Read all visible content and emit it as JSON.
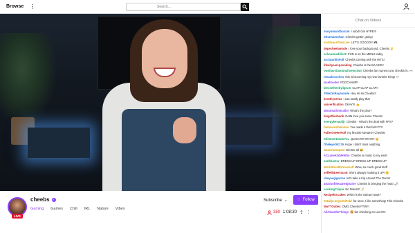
{
  "topbar": {
    "browse_label": "Browse",
    "more_label": "⋮",
    "search_placeholder": "Search..."
  },
  "stream": {
    "channel_name": "cheebs",
    "live_label": "LIVE",
    "tags": [
      "Gaming",
      "Games",
      "Chill",
      "IRL",
      "Nature",
      "Vibes"
    ],
    "subscribe_label": "Subscribe",
    "follow_label": "Follow",
    "viewer_count": "350",
    "uptime": "1:08:30"
  },
  "chat": {
    "title": "Chat on Videos",
    "messages": [
      {
        "user": "maryamandburcim",
        "text": "I subd! Get HYPE!!!",
        "color": "#1e6fd9"
      },
      {
        "user": "ShunnamChan",
        "text": "Cheebs gettin' going!",
        "color": "#1e6fd9"
      },
      {
        "user": "IceGlanceThruLive",
        "text": "LET'S GOOOO!!! 🎮",
        "color": "#d6a000"
      },
      {
        "user": "depecheelamode",
        "text": "I love your background, Cheebs 💡",
        "color": "#c01818"
      },
      {
        "user": "echoarmadillo22",
        "text": "FUN is on the MENU today",
        "color": "#1aa36b"
      },
      {
        "user": "arcSpardinFull",
        "text": "Cheebs coming with the HITS!",
        "color": "#1e6fd9"
      },
      {
        "user": "lifeeityearcpcooking",
        "text": "Cheebs is the BAAEE!!!",
        "color": "#c01818"
      },
      {
        "user": "ownhavsitantunahoetsxtwo",
        "text": "Cheebs fan numero uno checkin in. 👀",
        "color": "#1aa36b"
      },
      {
        "user": "ninaalecochoo",
        "text": "this is becoming my new favorite thing! 👀",
        "color": "#1e6fd9"
      },
      {
        "user": "lacellouder",
        "text": "POGCHAMP!",
        "color": "#8a3ffc"
      },
      {
        "user": "blessetheebyligrum",
        "text": "CLAP CLAP CLAP!!",
        "color": "#1aa36b"
      },
      {
        "user": "TrBeZinRaymonde",
        "text": "Hey Hi! Hi Cheebs!!",
        "color": "#1e6fd9"
      },
      {
        "user": "bestthyseeas",
        "text": "I can totally play that",
        "color": "#c01818"
      },
      {
        "user": "univerification",
        "text": "OKAY!!! 👍",
        "color": "#c01818"
      },
      {
        "user": "aboutsuthmicallor",
        "text": "What's the plan?",
        "color": "#8a3ffc"
      },
      {
        "user": "kingofburbank",
        "text": "Gotta love you some Cheebs",
        "color": "#c01818"
      },
      {
        "user": "energykevaultjr",
        "text": "Cheebs - What's the deal with FPS?",
        "color": "#1aa36b"
      },
      {
        "user": "fantuarsinhkinone",
        "text": "You made it this far!!!!?!?!",
        "color": "#d6a000"
      },
      {
        "user": "FullerOnHerRoll",
        "text": "my favorite streamer Cheebs!",
        "color": "#c01818"
      },
      {
        "user": "ShimmerDownYou",
        "text": "Queen!!!!!!!!!!!!!!!!!!! 👑",
        "color": "#1aa36b"
      },
      {
        "user": "OhHeyeOK176",
        "text": "Hope I didn't miss anything",
        "color": "#1e6fd9"
      },
      {
        "user": "wavestunnpwd",
        "text": "Gimme all 😆",
        "color": "#d6a000"
      },
      {
        "user": "ACLaneKlableWho",
        "text": "Cheebs is music to my ears!",
        "color": "#8a3ffc"
      },
      {
        "user": "sunkhamor",
        "text": "DRESS UP DRESS UP DRESS UP",
        "color": "#1aa36b"
      },
      {
        "user": "WorldGiveltlaYourself",
        "text": "Wow, so much good stuff",
        "color": "#d6a000"
      },
      {
        "user": "seffHill4reerScott",
        "text": "She's always hooking it UP! 🙂",
        "color": "#c01818"
      },
      {
        "user": "cheyesgigarroo",
        "text": "let's take a trip Around The Room!",
        "color": "#1e6fd9"
      },
      {
        "user": "attackoftheaaneighaine",
        "text": "Cheebs is bringing the heat! 🌶",
        "color": "#8a3ffc"
      },
      {
        "user": "cookingCrique",
        "text": "No Notes!!! 📝",
        "color": "#1aa36b"
      },
      {
        "user": "RecipeforCakes",
        "text": "When is the Stream Start?",
        "color": "#c01818"
      },
      {
        "user": "TotallyLnnypledFold",
        "text": "for once, I like something! This Cheebs",
        "color": "#d6a000"
      },
      {
        "user": "WaYTOuties",
        "text": "OMG Cheebs FTW!!!",
        "color": "#c01818"
      },
      {
        "user": "AllAboutheThings",
        "text": "🍔 fan checking on Live!!!!!!",
        "color": "#8a3ffc"
      }
    ]
  },
  "colors": {
    "accent": "#8a3ffc",
    "live_red": "#e5142b"
  }
}
